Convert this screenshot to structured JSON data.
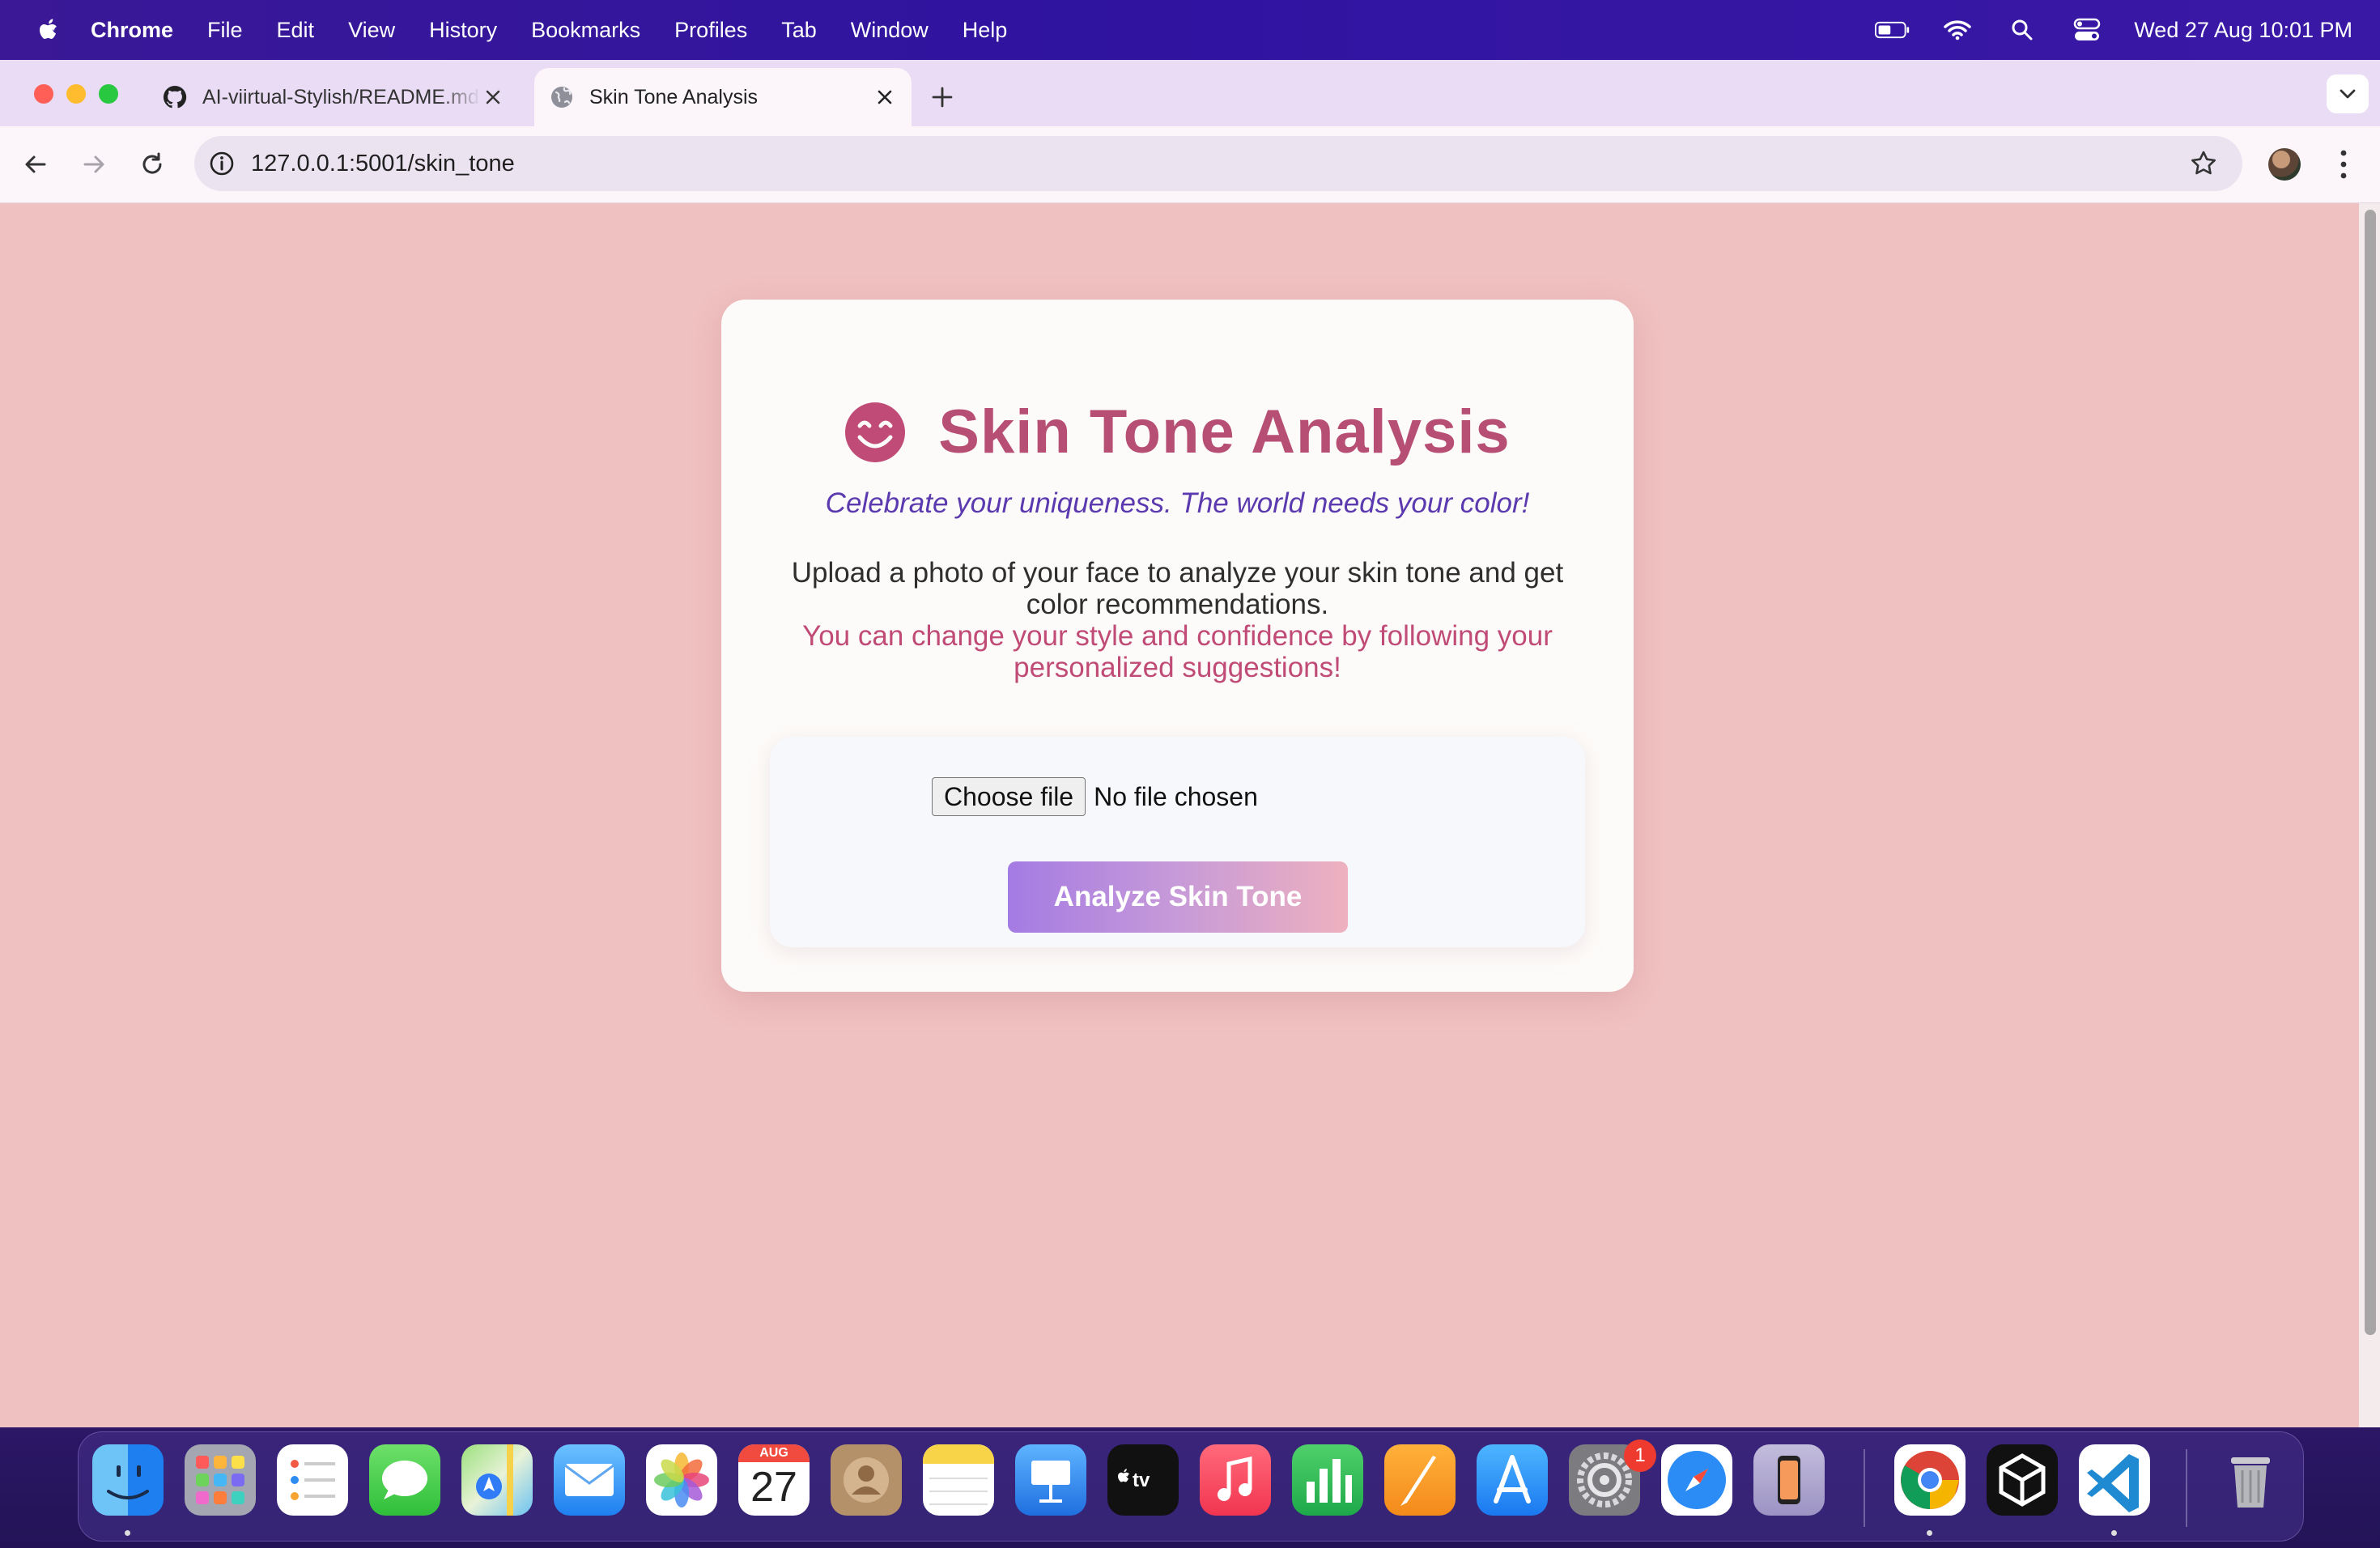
{
  "menubar": {
    "app_name": "Chrome",
    "menus": [
      "File",
      "Edit",
      "View",
      "History",
      "Bookmarks",
      "Profiles",
      "Tab",
      "Window",
      "Help"
    ],
    "clock": "Wed 27 Aug  10:01 PM"
  },
  "tabs": [
    {
      "title": "AI-viirtual-Stylish/README.md",
      "favicon": "github-icon",
      "active": false
    },
    {
      "title": "Skin Tone Analysis",
      "favicon": "globe-icon",
      "active": true
    }
  ],
  "toolbar": {
    "url": "127.0.0.1:5001/skin_tone"
  },
  "page": {
    "emoji_icon": "smiling-face-icon",
    "title": "Skin Tone Analysis",
    "tagline": "Celebrate your uniqueness. The world needs your color!",
    "description": "Upload a photo of your face to analyze your skin tone and get color recommendations.",
    "motivation": "You can change your style and confidence by following your personalized suggestions!",
    "file_button": "Choose file",
    "file_status": "No file chosen",
    "submit_label": "Analyze Skin Tone",
    "colors": {
      "background": "#f0c1c1",
      "title": "#b74f74",
      "tagline": "#5b3ab0",
      "motivation": "#c04b76"
    }
  },
  "dock": {
    "apps": [
      "Finder",
      "Launchpad",
      "Reminders",
      "Messages",
      "Maps",
      "Mail",
      "Photos",
      "Calendar",
      "Contacts",
      "Notes",
      "Keynote",
      "TV",
      "Music",
      "Numbers",
      "Pages",
      "App Store",
      "System Settings",
      "Safari",
      "iPhone Mirroring",
      "Google Chrome",
      "Unity",
      "Visual Studio Code",
      "Trash"
    ],
    "calendar_month": "AUG",
    "calendar_day": "27",
    "settings_badge": "1"
  }
}
